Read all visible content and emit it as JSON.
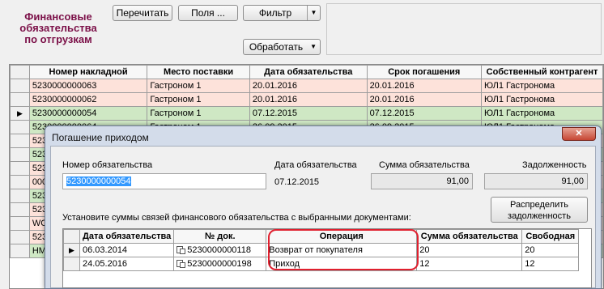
{
  "window": {
    "title_line1": "Финансовые",
    "title_line2": "обязательства",
    "title_line3": "по отгрузкам"
  },
  "toolbar": {
    "reread_label": "Перечитать",
    "fields_label": "Поля ...",
    "filter_label": "Фильтр",
    "process_label": "Обработать"
  },
  "main_grid": {
    "columns": [
      "Номер накладной",
      "Место поставки",
      "Дата обязательства",
      "Срок погашения",
      "Собственный контрагент"
    ],
    "rows": [
      {
        "num": "5230000000063",
        "place": "Гастроном 1",
        "date": "20.01.2016",
        "due": "20.01.2016",
        "contr": "ЮЛ1 Гастронома",
        "style": "pink"
      },
      {
        "num": "5230000000062",
        "place": "Гастроном 1",
        "date": "20.01.2016",
        "due": "20.01.2016",
        "contr": "ЮЛ1 Гастронома",
        "style": "pink"
      },
      {
        "num": "5230000000054",
        "place": "Гастроном 1",
        "date": "07.12.2015",
        "due": "07.12.2015",
        "contr": "ЮЛ1 Гастронома",
        "style": "green"
      },
      {
        "num": "5230000000064",
        "place": "Гастроном 1",
        "date": "26.09.2015",
        "due": "26.09.2015",
        "contr": "ЮЛ1 Гастронома",
        "style": "green"
      }
    ],
    "partial_rows": [
      "523",
      "523",
      "523",
      "000",
      "523",
      "523",
      "WO",
      "523",
      "HM"
    ]
  },
  "dialog": {
    "title": "Погашение приходом",
    "close_label": "✕",
    "obligation_number_label": "Номер обязательства",
    "obligation_number_value": "5230000000054",
    "obligation_date_label": "Дата обязательства",
    "obligation_date_value": "07.12.2015",
    "obligation_sum_label": "Сумма обязательства",
    "obligation_sum_value": "91,00",
    "debt_label": "Задолженность",
    "debt_value": "91,00",
    "distribute_line1": "Распределить",
    "distribute_line2": "задолженность",
    "instruction": "Установите суммы связей финансового обязательства с выбранными документами:",
    "columns": [
      "Дата обязательства",
      "№ док.",
      "Операция",
      "Сумма обязательства",
      "Свободная"
    ],
    "rows": [
      {
        "date": "06.03.2014",
        "doc": "5230000000118",
        "op": "Возврат от покупателя",
        "sum": "20",
        "free": "20"
      },
      {
        "date": "24.05.2016",
        "doc": "5230000000198",
        "op": "Приход",
        "sum": "12",
        "free": "12"
      }
    ]
  },
  "colors": {
    "title": "#7b1048",
    "row_pink": "#fde2da",
    "row_green": "#cfe8c4",
    "highlight": "#e0202f",
    "selection": "#3399ff"
  }
}
